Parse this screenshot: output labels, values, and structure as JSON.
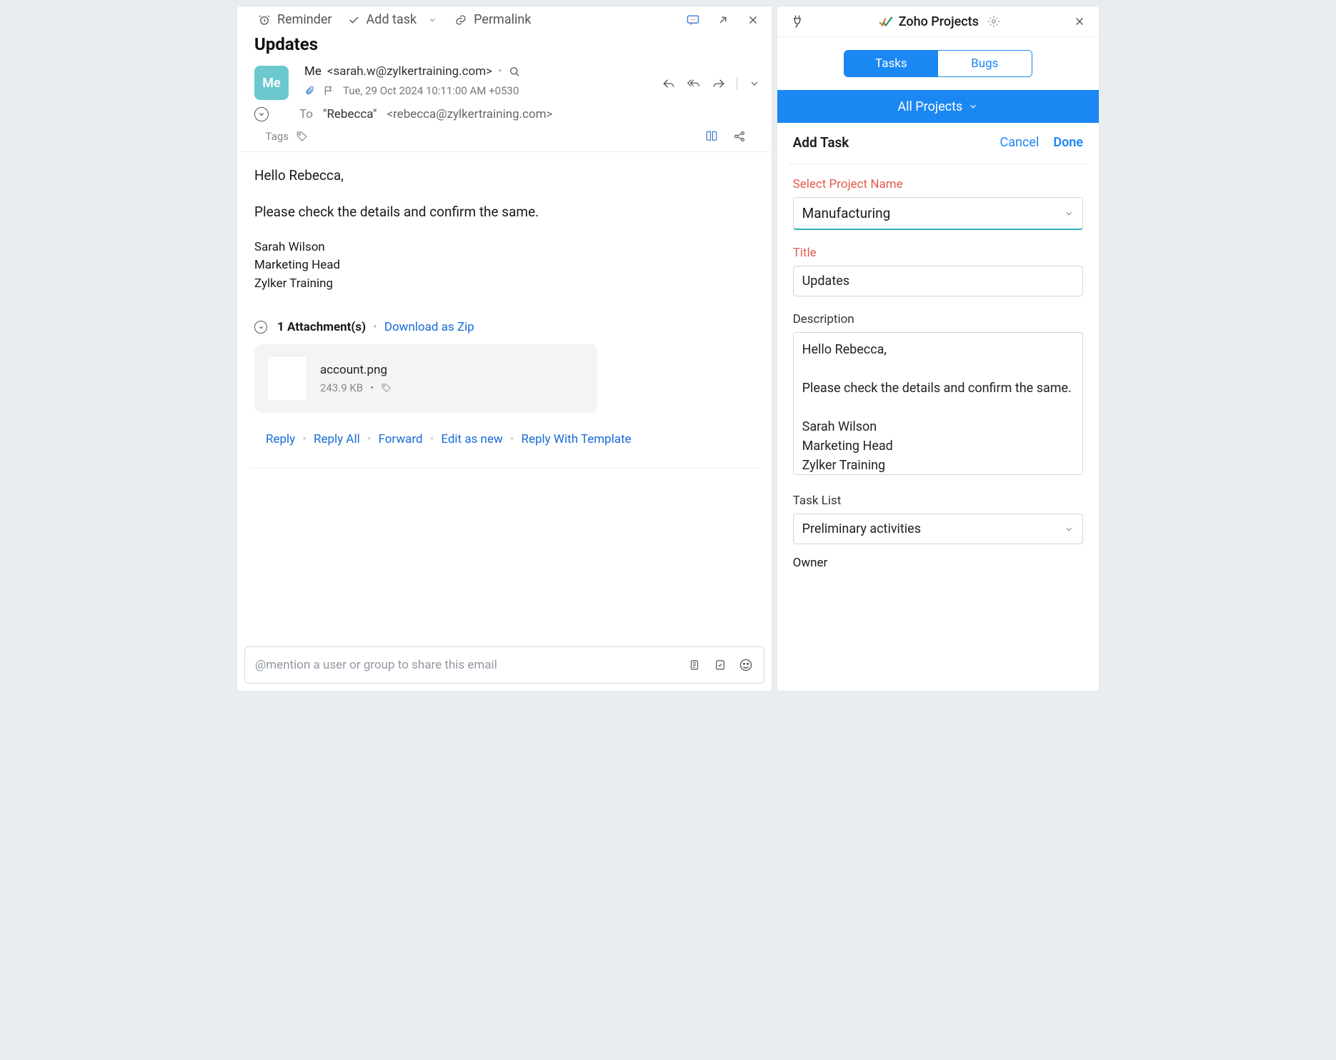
{
  "toolbar": {
    "reminder": "Reminder",
    "add_task": "Add task",
    "permalink": "Permalink"
  },
  "email": {
    "subject": "Updates",
    "avatar": "Me",
    "from_name": "Me",
    "from_email": "<sarah.w@zylkertraining.com>",
    "date": "Tue, 29 Oct 2024 10:11:00 AM +0530",
    "to_label": "To",
    "to_name": "\"Rebecca\"",
    "to_email": "<rebecca@zylkertraining.com>",
    "tags_label": "Tags",
    "body_greeting": "Hello Rebecca,",
    "body_line": "Please check the details and confirm the same.",
    "sig1": "Sarah Wilson",
    "sig2": "Marketing Head",
    "sig3": "Zylker Training",
    "attach_count_label": "1 Attachment(s)",
    "download_zip": "Download as Zip",
    "attachment": {
      "name": "account.png",
      "size": "243.9 KB"
    },
    "actions": {
      "reply": "Reply",
      "reply_all": "Reply All",
      "forward": "Forward",
      "edit_as_new": "Edit as new",
      "reply_with_template": "Reply With Template"
    },
    "mention_placeholder": "@mention a user or group to share this email"
  },
  "side": {
    "app_name": "Zoho Projects",
    "tabs": {
      "tasks": "Tasks",
      "bugs": "Bugs"
    },
    "projects_dropdown": "All Projects",
    "add_task_title": "Add Task",
    "cancel": "Cancel",
    "done": "Done",
    "labels": {
      "project": "Select Project Name",
      "title": "Title",
      "description": "Description",
      "task_list": "Task List",
      "owner": "Owner"
    },
    "values": {
      "project": "Manufacturing",
      "title": "Updates",
      "description": "Hello Rebecca,\n\nPlease check the details and confirm the same.\n\nSarah Wilson\nMarketing Head\nZylker Training",
      "task_list": "Preliminary activities"
    }
  }
}
